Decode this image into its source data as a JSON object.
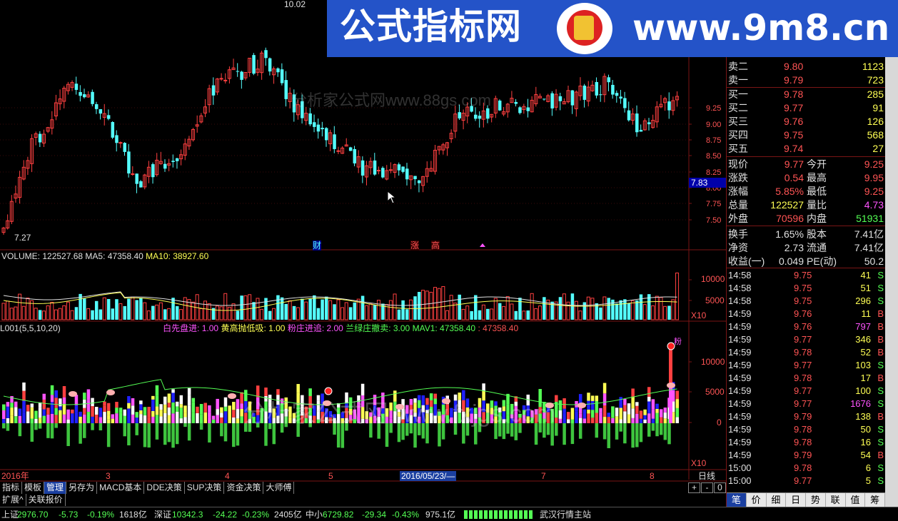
{
  "banner": {
    "title": "公式指标网",
    "site": "www.9m8.cn"
  },
  "watermarks": {
    "wm1": "分析家公式网www.88gs.com",
    "wm2": "分析家公式网 www.fxjgs.com"
  },
  "kline": {
    "high_label": "10.02",
    "low_label": "7.27",
    "cur_price_tag": "7.83",
    "price_ticks": [
      "9.25",
      "9.00",
      "8.75",
      "8.50",
      "8.25",
      "8.00",
      "7.75",
      "7.50"
    ],
    "markers": [
      "财",
      "涨",
      "高"
    ]
  },
  "volume": {
    "label": "VOLUME: 122527.68",
    "ma5": "MA5: 47358.40",
    "ma10": "MA10: 38927.60",
    "ticks": [
      "10000",
      "5000"
    ],
    "unit": "X10"
  },
  "indicator": {
    "name": "L001(5,5,10,20)",
    "l1": "白先盘进: 1.00",
    "l2": "黄高抛低吸: 1.00",
    "l3": "粉庄进追: 2.00",
    "l4": "兰绿庄撤卖: 3.00",
    "l5": "MAV1: 47358.40",
    "l6": ": 47358.40",
    "ticks": [
      "10000",
      "5000",
      "0"
    ],
    "unit": "X10",
    "top_mark": "粉"
  },
  "xaxis": {
    "labels": [
      "2016年",
      "3",
      "4",
      "5",
      "2016/05/23/—",
      "7",
      "8"
    ],
    "period": "日线"
  },
  "order_book": [
    {
      "label": "卖二",
      "price": "9.80",
      "vol": "1123"
    },
    {
      "label": "卖一",
      "price": "9.79",
      "vol": "723"
    },
    {
      "label": "买一",
      "price": "9.78",
      "vol": "285"
    },
    {
      "label": "买二",
      "price": "9.77",
      "vol": "91"
    },
    {
      "label": "买三",
      "price": "9.76",
      "vol": "126"
    },
    {
      "label": "买四",
      "price": "9.75",
      "vol": "568"
    },
    {
      "label": "买五",
      "price": "9.74",
      "vol": "27"
    }
  ],
  "quote": [
    {
      "k1": "现价",
      "v1": "9.77",
      "k2": "今开",
      "v2": "9.25"
    },
    {
      "k1": "涨跌",
      "v1": "0.54",
      "k2": "最高",
      "v2": "9.95"
    },
    {
      "k1": "涨幅",
      "v1": "5.85%",
      "k2": "最低",
      "v2": "9.25"
    },
    {
      "k1": "总量",
      "v1": "122527",
      "k2": "量比",
      "v2": "4.73"
    },
    {
      "k1": "外盘",
      "v1": "70596",
      "k2": "内盘",
      "v2": "51931"
    },
    {
      "k1": "换手",
      "v1": "1.65%",
      "k2": "股本",
      "v2": "7.41亿"
    },
    {
      "k1": "净资",
      "v1": "2.73",
      "k2": "流通",
      "v2": "7.41亿"
    },
    {
      "k1": "收益(一)",
      "v1": "0.049",
      "k2": "PE(动)",
      "v2": "50.2"
    }
  ],
  "ticks": [
    {
      "time": "14:58",
      "price": "9.75",
      "vol": "41",
      "bs": "S"
    },
    {
      "time": "14:58",
      "price": "9.75",
      "vol": "51",
      "bs": "S"
    },
    {
      "time": "14:58",
      "price": "9.75",
      "vol": "296",
      "bs": "S"
    },
    {
      "time": "14:59",
      "price": "9.76",
      "vol": "11",
      "bs": "B"
    },
    {
      "time": "14:59",
      "price": "9.76",
      "vol": "797",
      "bs": "B"
    },
    {
      "time": "14:59",
      "price": "9.77",
      "vol": "346",
      "bs": "B"
    },
    {
      "time": "14:59",
      "price": "9.78",
      "vol": "52",
      "bs": "B"
    },
    {
      "time": "14:59",
      "price": "9.77",
      "vol": "103",
      "bs": "S"
    },
    {
      "time": "14:59",
      "price": "9.78",
      "vol": "17",
      "bs": "B"
    },
    {
      "time": "14:59",
      "price": "9.77",
      "vol": "100",
      "bs": "S"
    },
    {
      "time": "14:59",
      "price": "9.77",
      "vol": "1676",
      "bs": "S"
    },
    {
      "time": "14:59",
      "price": "9.79",
      "vol": "138",
      "bs": "B"
    },
    {
      "time": "14:59",
      "price": "9.78",
      "vol": "50",
      "bs": "S"
    },
    {
      "time": "14:59",
      "price": "9.78",
      "vol": "16",
      "bs": "S"
    },
    {
      "time": "14:59",
      "price": "9.79",
      "vol": "54",
      "bs": "B"
    },
    {
      "time": "15:00",
      "price": "9.78",
      "vol": "6",
      "bs": "S"
    },
    {
      "time": "15:00",
      "price": "9.77",
      "vol": "5",
      "bs": "S"
    }
  ],
  "bottom_tabs": [
    "指标",
    "模板",
    "管理",
    "另存为",
    "MACD基本",
    "DDE决策",
    "SUP决策",
    "资金决策",
    "大师傅"
  ],
  "bottom_tabs2": [
    "扩展^",
    "关联报价"
  ],
  "zoom_buttons": [
    "+",
    "-",
    "0"
  ],
  "right_tabs": [
    "笔",
    "价",
    "细",
    "日",
    "势",
    "联",
    "值",
    "筹"
  ],
  "status": {
    "sh": "上证",
    "sh_v": "2976.70",
    "sh_c": "-5.73",
    "sh_p": "-0.19%",
    "sh_a": "1618亿",
    "sz": "深证",
    "sz_v": "10342.3",
    "sz_c": "-24.22",
    "sz_p": "-0.23%",
    "sz_a": "2405亿",
    "zx": "中小",
    "zx_v": "6729.82",
    "zx_c": "-29.34",
    "zx_p": "-0.43%",
    "zx_a": "975.1亿",
    "station": "武汉行情主站"
  },
  "colors": {
    "up": "#ff4040",
    "down": "#54ffff",
    "grid": "#7a1515",
    "yellow": "#ffff54",
    "magenta": "#ff54ff",
    "green": "#54ff54"
  }
}
